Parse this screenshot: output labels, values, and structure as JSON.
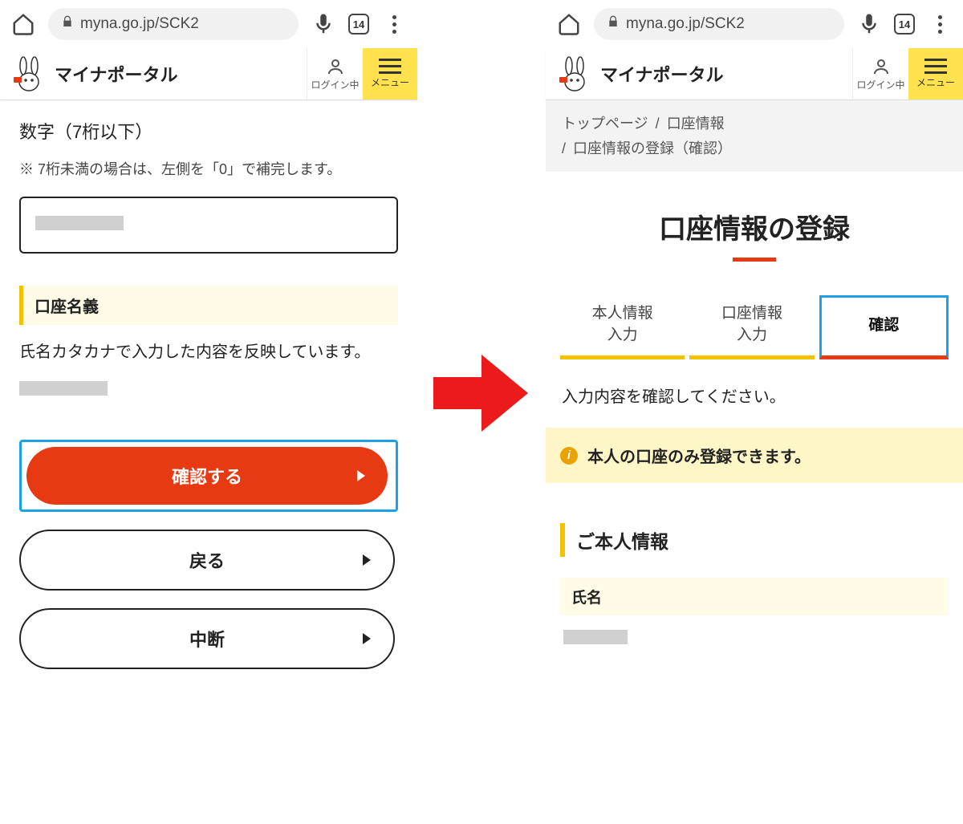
{
  "browser": {
    "url": "myna.go.jp/SCK2",
    "tab_count": "14"
  },
  "header": {
    "app_name": "マイナポータル",
    "login_status": "ログイン中",
    "menu_label": "メニュー"
  },
  "left": {
    "field_label": "数字（7桁以下）",
    "hint": "※ 7桁未満の場合は、左側を「0」で補完します。",
    "section_title": "口座名義",
    "section_desc": "氏名カタカナで入力した内容を反映しています。",
    "btn_confirm": "確認する",
    "btn_back": "戻る",
    "btn_cancel": "中断"
  },
  "right": {
    "breadcrumbs": {
      "a": "トップページ",
      "sep": "/",
      "b": "口座情報",
      "c": "口座情報の登録（確認）"
    },
    "page_title": "口座情報の登録",
    "steps": {
      "s1": "本人情報\n入力",
      "s2": "口座情報\n入力",
      "s3": "確認"
    },
    "instruction": "入力内容を確認してください。",
    "notice": "本人の口座のみ登録できます。",
    "section_title": "ご本人情報",
    "sub_title": "氏名"
  }
}
